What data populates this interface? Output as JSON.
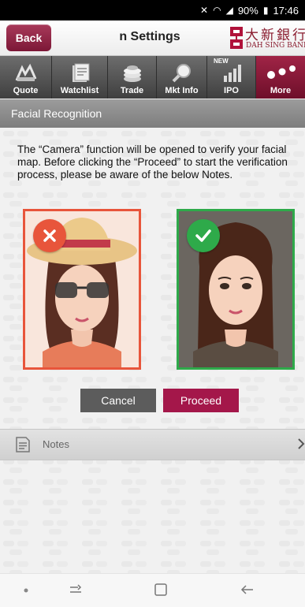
{
  "status": {
    "battery": "90%",
    "time": "17:46"
  },
  "header": {
    "back_label": "Back",
    "title": "n Settings",
    "logo_cn": "大新銀行",
    "logo_en": "DAH SING BANK"
  },
  "tabs": [
    {
      "label": "Quote",
      "icon": "quote-icon"
    },
    {
      "label": "Watchlist",
      "icon": "watchlist-icon"
    },
    {
      "label": "Trade",
      "icon": "trade-icon"
    },
    {
      "label": "Mkt Info",
      "icon": "magnifier-icon"
    },
    {
      "label": "IPO",
      "icon": "ipo-chart-icon",
      "badge": "NEW"
    },
    {
      "label": "More",
      "icon": "more-dots-icon",
      "active": true
    }
  ],
  "section": {
    "title": "Facial Recognition"
  },
  "description": "The “Camera” function will be opened to verify your facial map. Before clicking the “Proceed” to start the verification process, please be aware of the below Notes.",
  "examples": {
    "incorrect": {
      "badge_icon": "cross-icon",
      "color": "#e8553b"
    },
    "correct": {
      "badge_icon": "check-icon",
      "color": "#2eaa4a"
    }
  },
  "buttons": {
    "cancel": "Cancel",
    "proceed": "Proceed"
  },
  "notes": {
    "label": "Notes"
  },
  "colors": {
    "brand": "#a4174a",
    "section_bar": "#8d8d8d"
  }
}
